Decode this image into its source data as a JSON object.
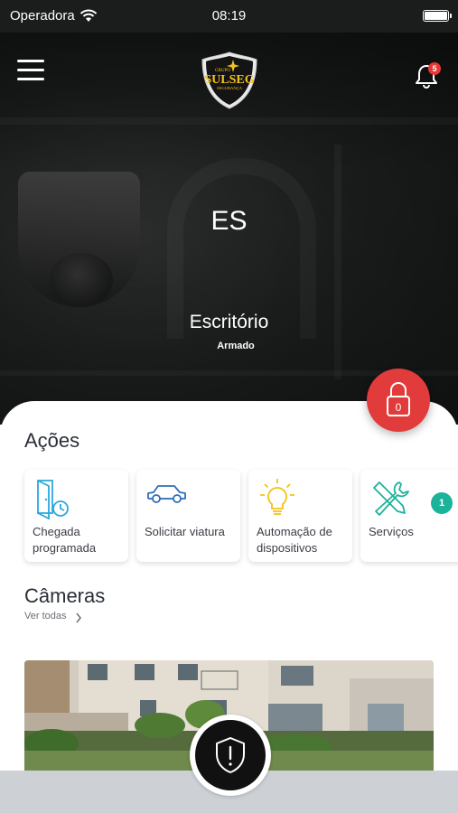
{
  "status_bar": {
    "carrier": "Operadora",
    "time": "08:19"
  },
  "header": {
    "logo_top": "GRUPO",
    "logo_brand": "SULSEG",
    "logo_bottom": "SEGURANÇA",
    "notification_count": "5"
  },
  "hero": {
    "initials": "ES",
    "name": "Escritório",
    "status": "Armado"
  },
  "lock": {
    "count": "0",
    "color": "#e23b3b"
  },
  "actions": {
    "title": "Ações",
    "items": [
      {
        "label": "Chegada programada",
        "icon": "scheduled-arrival-icon"
      },
      {
        "label": "Solicitar viatura",
        "icon": "car-icon"
      },
      {
        "label": "Automação de dispositivos",
        "icon": "lightbulb-icon"
      },
      {
        "label": "Serviços",
        "icon": "tools-icon",
        "badge": "1"
      }
    ]
  },
  "cameras": {
    "title": "Câmeras",
    "see_all": "Ver todas"
  },
  "colors": {
    "accent_teal": "#1bb39a",
    "alert_red": "#e53935",
    "bulb_yellow": "#f2c318",
    "icon_blue": "#2d6fb7"
  }
}
